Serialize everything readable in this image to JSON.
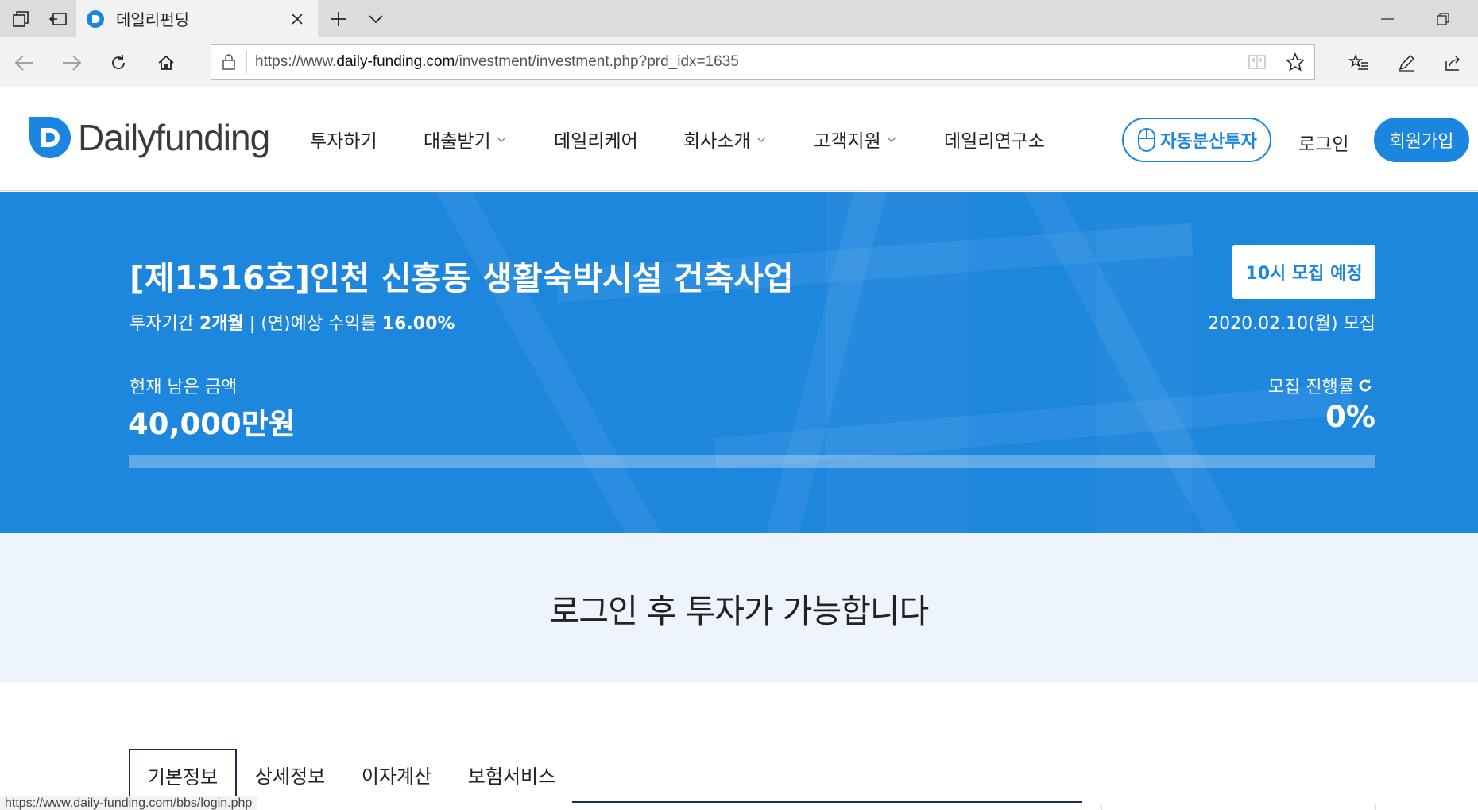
{
  "browser": {
    "tab_title": "데일리펀딩",
    "url_prefix": "https://www.",
    "url_host": "daily-funding.com",
    "url_path": "/investment/investment.php?prd_idx=1635",
    "status_url": "https://www.daily-funding.com/bbs/login.php"
  },
  "header": {
    "logo_text": "Dailyfunding",
    "menu": [
      {
        "label": "투자하기",
        "has_caret": false
      },
      {
        "label": "대출받기",
        "has_caret": true
      },
      {
        "label": "데일리케어",
        "has_caret": false
      },
      {
        "label": "회사소개",
        "has_caret": true
      },
      {
        "label": "고객지원",
        "has_caret": true
      },
      {
        "label": "데일리연구소",
        "has_caret": false
      }
    ],
    "auto_invest_label": "자동분산투자",
    "login_label": "로그인",
    "signup_label": "회원가입"
  },
  "product": {
    "title": "[제1516호]인천 신흥동 생활숙박시설 건축사업",
    "period_label": "투자기간",
    "period_value": "2개월",
    "separator": "|",
    "rate_label": "(연)예상 수익률",
    "rate_value": "16.00%",
    "status_badge": "10시 모집 예정",
    "recruit_date": "2020.02.10(월) 모집",
    "remaining_label": "현재 남은 금액",
    "remaining_value": "40,000만원",
    "progress_label": "모집 진행률",
    "progress_value": "0%",
    "progress_fraction": 0
  },
  "notice": {
    "text": "로그인 후 투자가 가능합니다"
  },
  "content_tabs": [
    "기본정보",
    "상세정보",
    "이자계산",
    "보험서비스"
  ],
  "colors": {
    "brand_blue": "#1a86e0",
    "hero_blue": "#1d86dd",
    "notice_bg": "#eef4fb",
    "tab_border": "#1b2f4b"
  }
}
